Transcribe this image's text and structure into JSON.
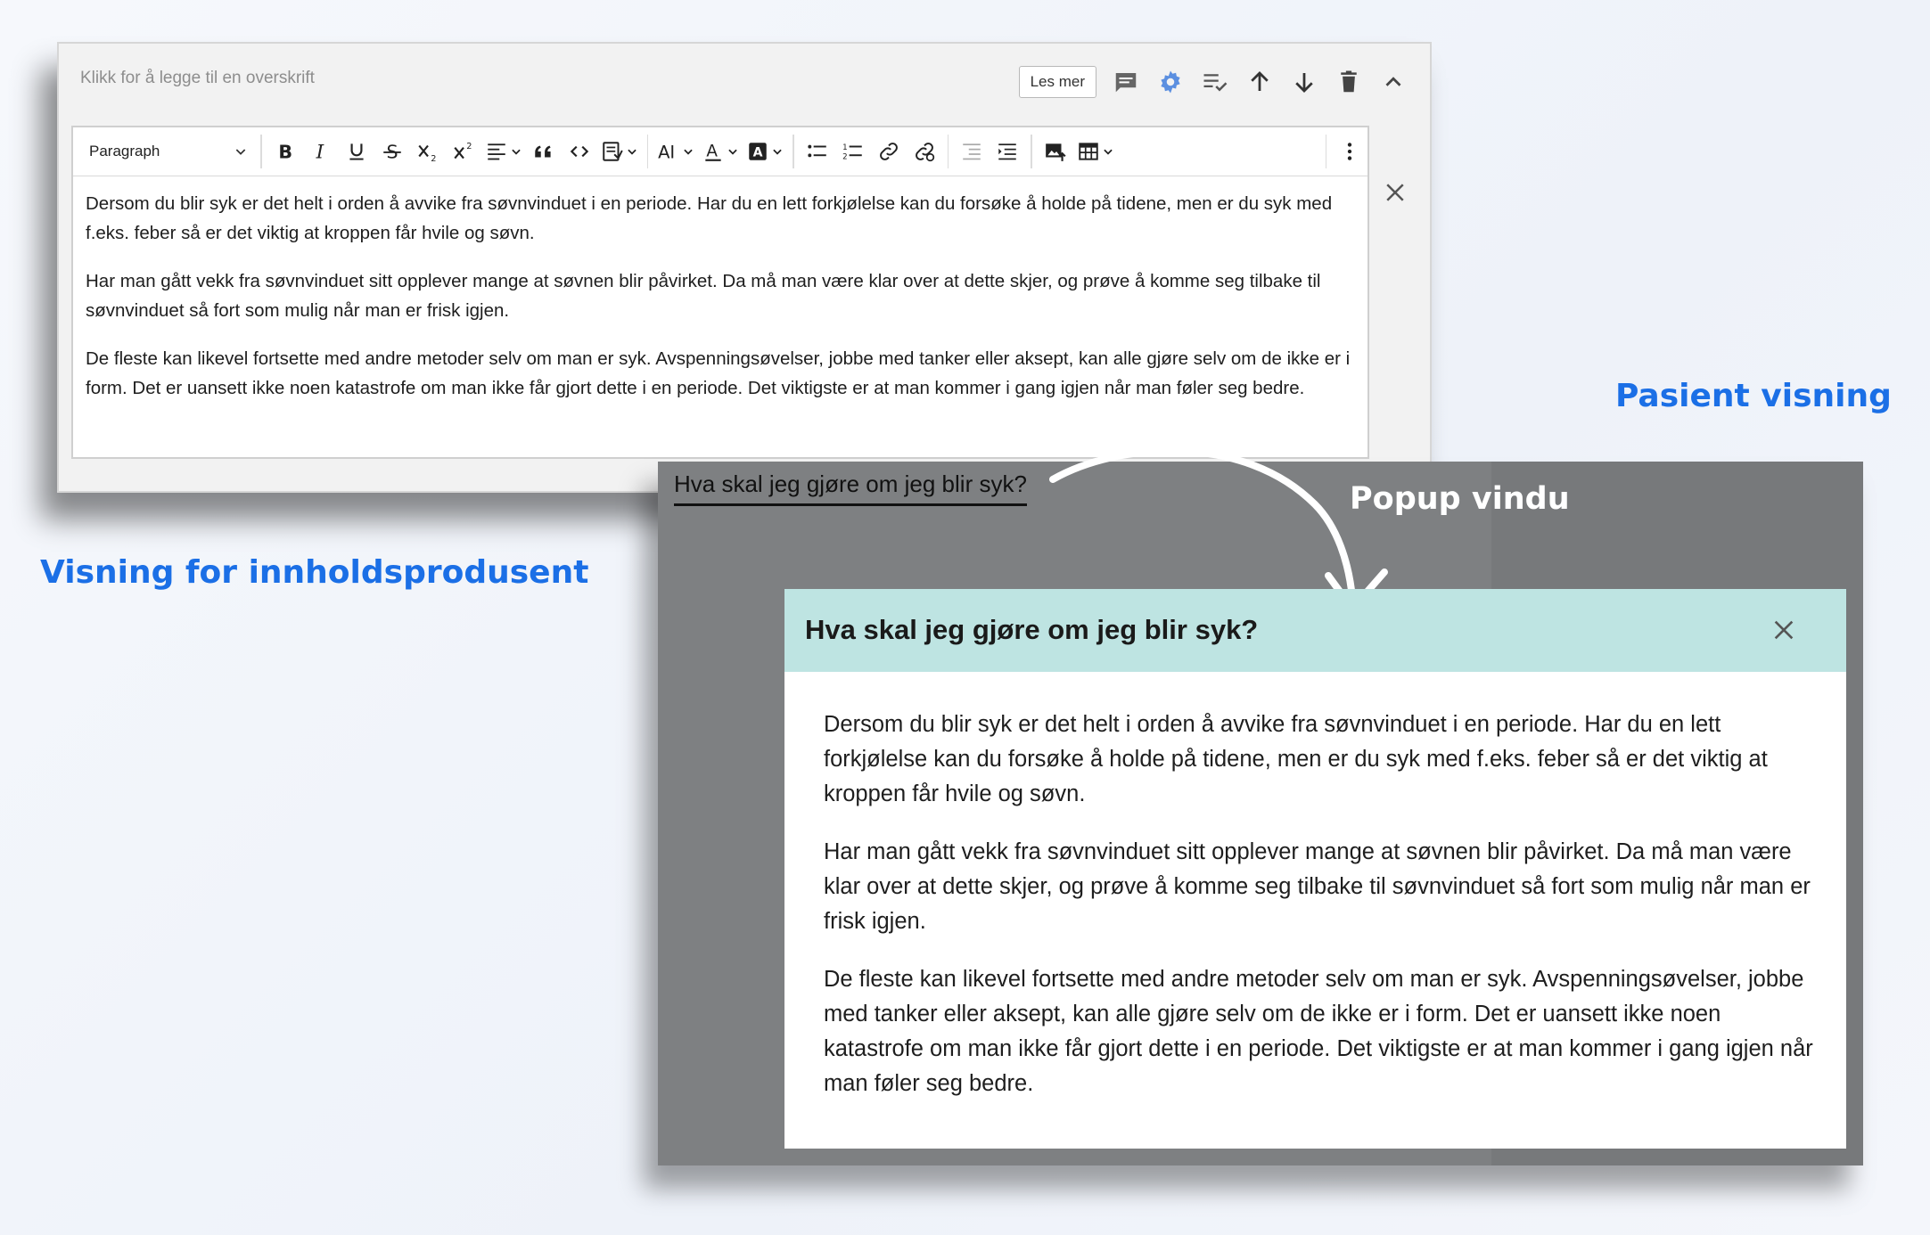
{
  "captions": {
    "editor_view": "Visning for innholdsprodusent",
    "patient_view": "Pasient visning",
    "popup": "Popup vindu"
  },
  "editor": {
    "heading_placeholder": "Klikk for å legge til en overskrift",
    "les_mer_label": "Les mer",
    "header_icons": [
      "comment-icon",
      "gear-icon",
      "checklist-icon",
      "arrow-up-icon",
      "arrow-down-icon",
      "trash-icon",
      "chevron-up-icon"
    ],
    "toolbar": {
      "paragraph_select": "Paragraph",
      "buttons": [
        "bold",
        "italic",
        "underline",
        "strikethrough",
        "subscript",
        "superscript",
        "align",
        "blockquote",
        "code",
        "insert-template",
        "font-size",
        "font-color",
        "highlight",
        "bulleted-list",
        "numbered-list",
        "link",
        "unlink",
        "outdent",
        "indent",
        "insert-image",
        "table",
        "more"
      ]
    },
    "paragraphs": [
      "Dersom du blir syk er det helt i orden å avvike fra søvnvinduet i en periode. Har du en lett forkjølelse kan du forsøke å holde på tidene, men er du syk med f.eks. feber så er det viktig at kroppen får hvile og søvn.",
      "Har man gått vekk fra søvnvinduet sitt opplever mange at søvnen blir påvirket. Da må man være klar over at dette skjer, og prøve å komme seg tilbake til søvnvinduet så fort som mulig når man er frisk igjen.",
      "De fleste kan likevel fortsette med andre metoder selv om man er syk. Avspenningsøvelser, jobbe med tanker eller aksept, kan alle gjøre selv om de ikke er i form. Det er uansett ikke noen katastrofe om man ikke får gjort dette i en periode. Det viktigste er at man kommer i gang igjen når man føler seg bedre."
    ]
  },
  "patient": {
    "link_text": "Hva skal jeg gjøre om jeg blir syk?",
    "modal": {
      "title": "Hva skal jeg gjøre om jeg blir syk?",
      "paragraphs": [
        "Dersom du blir syk er det helt i orden å avvike fra søvnvinduet i en periode. Har du en lett forkjølelse kan du forsøke å holde på tidene, men er du syk med f.eks. feber så er det viktig at kroppen får hvile og søvn.",
        "Har man gått vekk fra søvnvinduet sitt opplever mange at søvnen blir påvirket. Da må man være klar over at dette skjer, og prøve å komme seg tilbake til søvnvinduet så fort som mulig når man er frisk igjen.",
        "De fleste kan likevel fortsette med andre metoder selv om man er syk. Avspenningsøvelser, jobbe med tanker eller aksept, kan alle gjøre selv om de ikke er i form. Det er uansett ikke noen katastrofe om man ikke får gjort dette i en periode. Det viktigste er at man kommer i gang igjen når man føler seg bedre."
      ]
    }
  },
  "colors": {
    "caption_blue": "#1b6fe6",
    "modal_header": "#bee4e2",
    "gear_blue": "#5b8fe0",
    "overlay_gray": "#7e8082"
  }
}
